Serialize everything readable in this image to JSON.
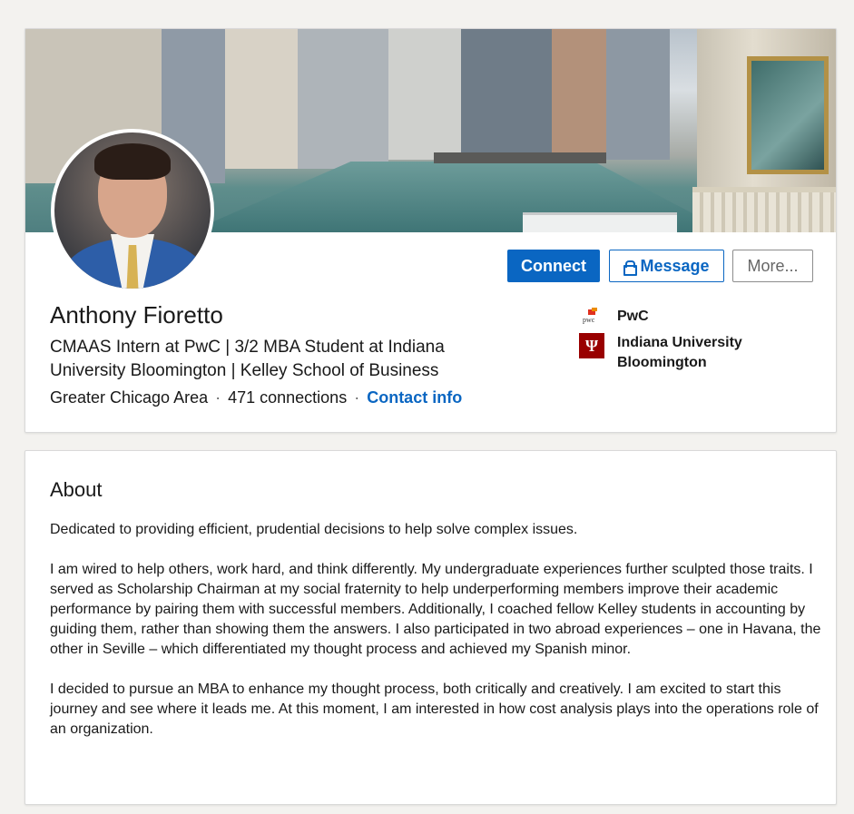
{
  "profile": {
    "name": "Anthony Fioretto",
    "headline": "CMAAS Intern at PwC | 3/2 MBA Student at Indiana University Bloomington | Kelley School of Business",
    "location": "Greater Chicago Area",
    "connections": "471 connections",
    "contact_info": "Contact info",
    "separator": "·"
  },
  "actions": {
    "connect": "Connect",
    "message": "Message",
    "more": "More..."
  },
  "orgs": {
    "current": "PwC",
    "pwc_logo_text": "pwc",
    "education": "Indiana University Bloomington",
    "iu_logo_text": "Ψ"
  },
  "about": {
    "title": "About",
    "paragraphs": [
      "Dedicated to providing efficient, prudential decisions to help solve complex issues.",
      "I am wired to help others, work hard, and think differently. My undergraduate experiences further sculpted those traits. I served as Scholarship Chairman at my social fraternity to help underperforming members improve their academic performance by pairing them with successful members. Additionally, I coached fellow Kelley students in accounting by guiding them, rather than showing them the answers. I also participated in two abroad experiences – one in Havana, the other in Seville – which differentiated my thought process and achieved my Spanish minor.",
      "I decided to pursue an MBA to enhance my thought process, both critically and creatively. I am excited to start this journey and see where it leads me. At this moment, I am interested in how cost analysis plays into the operations role of an organization."
    ]
  },
  "colors": {
    "brand_blue": "#0a66c2",
    "iu_crimson": "#990000"
  },
  "icons": {
    "message_button": "lock-icon"
  }
}
